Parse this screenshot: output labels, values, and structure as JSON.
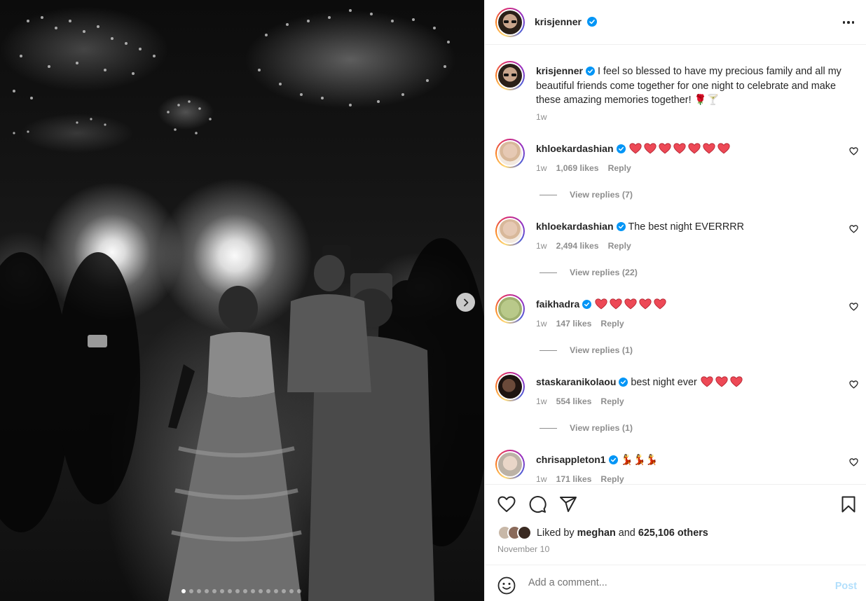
{
  "post": {
    "author": "krisjenner",
    "caption": "I feel so blessed to have my precious family and all my beautiful friends come together for one night to celebrate and make these amazing memories together! 🌹🍸",
    "caption_age": "1w",
    "carousel": {
      "total": 16,
      "current": 1
    }
  },
  "comments": [
    {
      "username": "khloekardashian",
      "text": "",
      "hearts": 7,
      "age": "1w",
      "likes": "1,069 likes",
      "reply_label": "Reply",
      "view_replies": "View replies (7)"
    },
    {
      "username": "khloekardashian",
      "text": "The best night EVERRRR",
      "hearts": 0,
      "age": "1w",
      "likes": "2,494 likes",
      "reply_label": "Reply",
      "view_replies": "View replies (22)"
    },
    {
      "username": "faikhadra",
      "text": "",
      "hearts": 5,
      "age": "1w",
      "likes": "147 likes",
      "reply_label": "Reply",
      "view_replies": "View replies (1)"
    },
    {
      "username": "staskaranikolaou",
      "text": "best night ever",
      "hearts": 3,
      "age": "1w",
      "likes": "554 likes",
      "reply_label": "Reply",
      "view_replies": "View replies (1)"
    },
    {
      "username": "chrisappleton1",
      "text": "💃💃💃",
      "hearts": 0,
      "age": "1w",
      "likes": "171 likes",
      "reply_label": "Reply",
      "view_replies": ""
    }
  ],
  "actions": {
    "icons": [
      "heart-icon",
      "comment-icon",
      "share-icon",
      "bookmark-icon"
    ],
    "liked_by_prefix": "Liked by",
    "liked_by_user": "meghan",
    "liked_by_and": "and",
    "liked_by_others": "625,106 others",
    "date": "November 10"
  },
  "composer": {
    "placeholder": "Add a comment...",
    "post_label": "Post"
  },
  "colors": {
    "verified": "#0095f6",
    "heart": "#ed4956",
    "post_disabled": "#b2dffc",
    "secondary_text": "#8e8e8e"
  }
}
